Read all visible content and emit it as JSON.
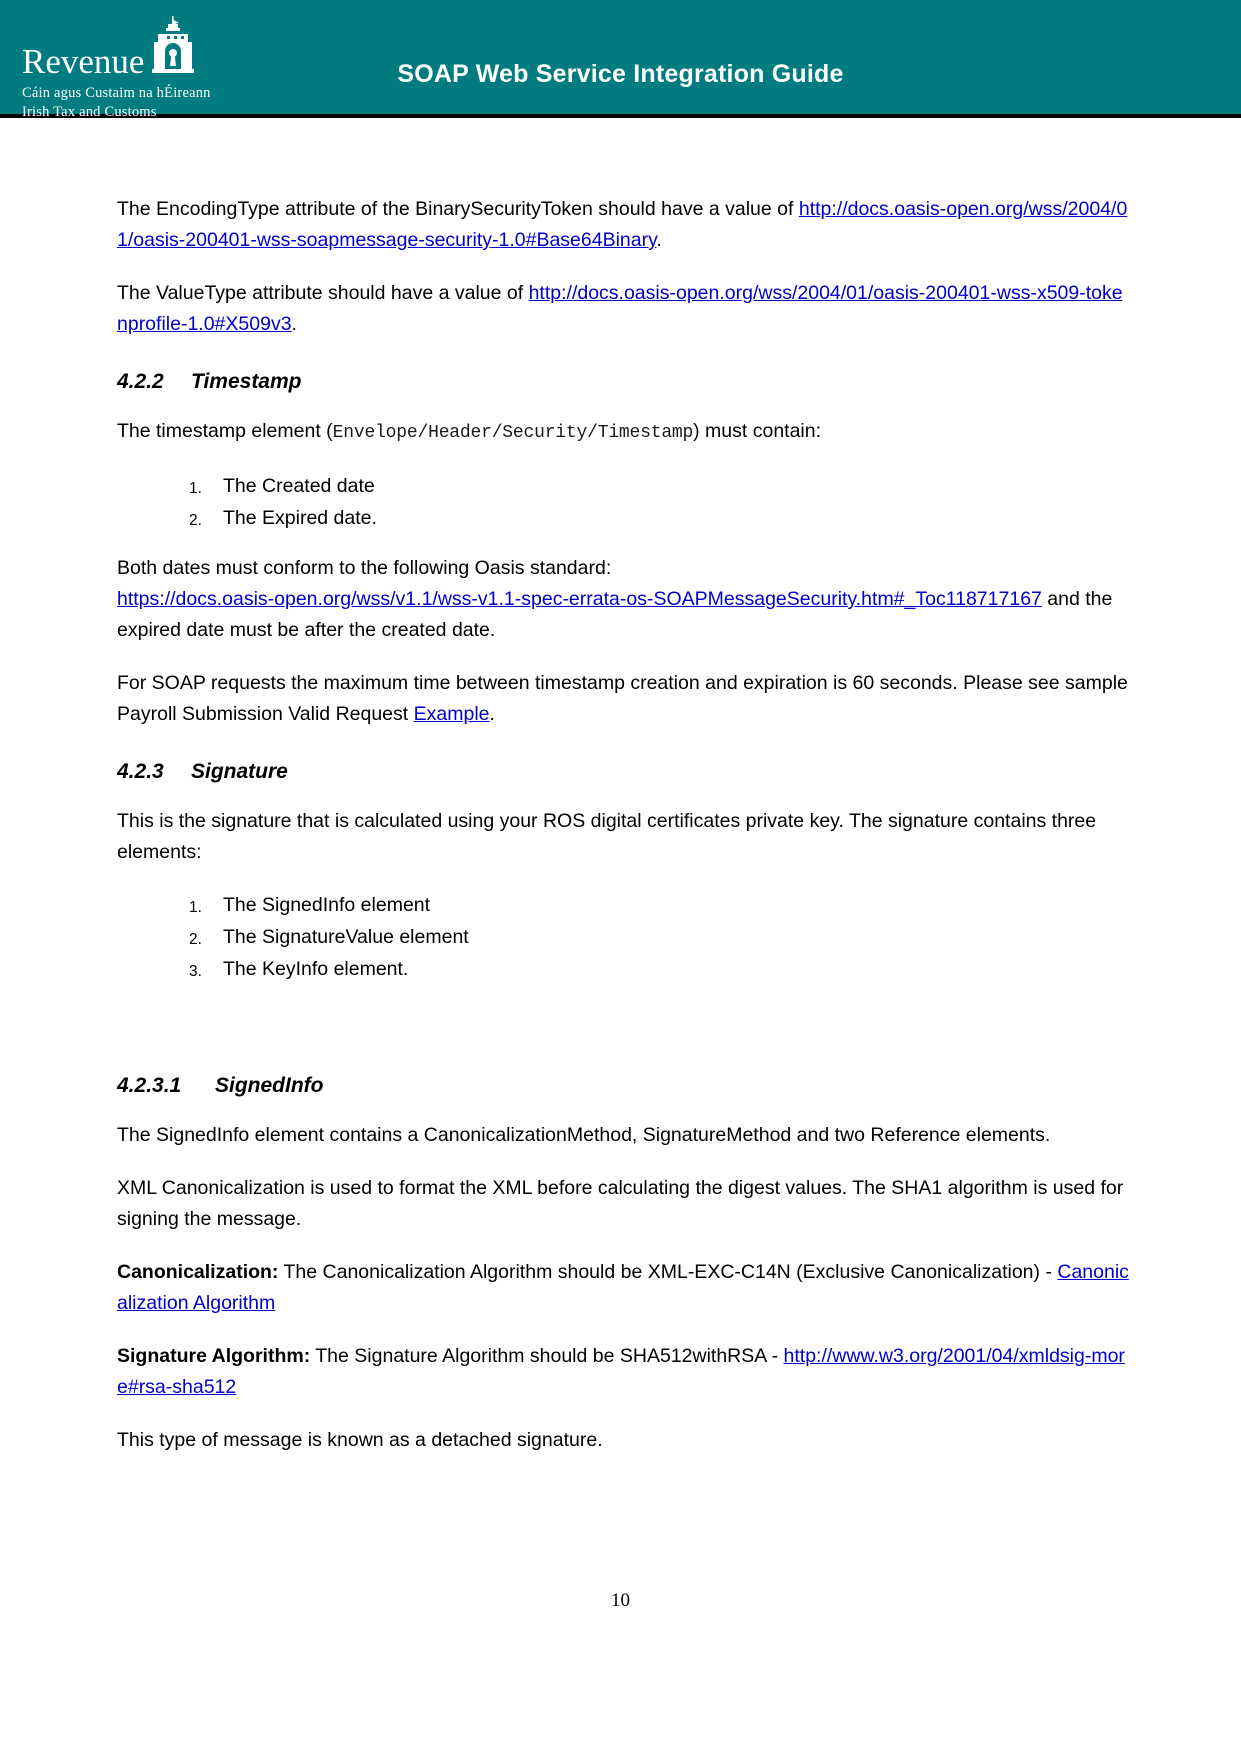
{
  "header": {
    "title": "SOAP Web Service Integration Guide",
    "background_color": "#007b7f",
    "logo": {
      "wordmark": "Revenue",
      "subtitle_irish": "Cáin agus Custaim na hÉireann",
      "subtitle_english": "Irish Tax and Customs",
      "crest_icon": "revenue-castle-gateway-icon"
    }
  },
  "body": {
    "para_encoding_type": {
      "before": "The EncodingType attribute of the BinarySecurityToken should have a value of ",
      "link": "http://docs.oasis-open.org/wss/2004/01/oasis-200401-wss-soapmessage-security-1.0#Base64Binary",
      "after": "."
    },
    "para_value_type": {
      "before": "The ValueType attribute should have a value of ",
      "link": "http://docs.oasis-open.org/wss/2004/01/oasis-200401-wss-x509-tokenprofile-1.0#X509v3",
      "after": "."
    },
    "heading_422": {
      "number": "4.2.2",
      "text": "Timestamp"
    },
    "para_timestamp_element": {
      "before": "The timestamp element (",
      "code": "Envelope/Header/Security/Timestamp",
      "after": ") must contain:"
    },
    "timestamp_list": [
      "The Created date",
      "The Expired date."
    ],
    "para_oasis_standard": {
      "line1": "Both dates must conform to the following Oasis standard:",
      "link": "https://docs.oasis-open.org/wss/v1.1/wss-v1.1-spec-errata-os-SOAPMessageSecurity.htm#_Toc118717167",
      "after": " and the expired date must be after the created date."
    },
    "para_max_time": {
      "line1": "For SOAP requests the maximum time between timestamp creation and expiration is 60 seconds.",
      "line2_before": "Please see sample Payroll Submission Valid Request ",
      "line2_link": "Example",
      "line2_after": "."
    },
    "heading_423": {
      "number": "4.2.3",
      "text": "Signature"
    },
    "para_signature_intro": "This is the signature that is calculated using your ROS digital certificates private key. The signature contains three elements:",
    "signature_list": [
      "The SignedInfo element",
      "The SignatureValue element",
      "The KeyInfo element."
    ],
    "heading_4231": {
      "number": "4.2.3.1",
      "text": "SignedInfo"
    },
    "para_signedinfo": "The SignedInfo element contains a CanonicalizationMethod, SignatureMethod and two Reference elements.",
    "para_xml_canon": "XML Canonicalization is used to format the XML before calculating the digest values. The SHA1 algorithm is used for signing the message.",
    "para_canonicalization": {
      "label": "Canonicalization:",
      "text": " The Canonicalization Algorithm should be XML-EXC-C14N (Exclusive Canonicalization) - ",
      "link": "Canonicalization Algorithm"
    },
    "para_signature_algorithm": {
      "label": "Signature Algorithm:",
      "text": " The Signature Algorithm should be SHA512withRSA - ",
      "link": "http://www.w3.org/2001/04/xmldsig-more#rsa-sha512"
    },
    "para_detached": "This type of message is known as a detached signature."
  },
  "footer": {
    "page_number": "10"
  }
}
